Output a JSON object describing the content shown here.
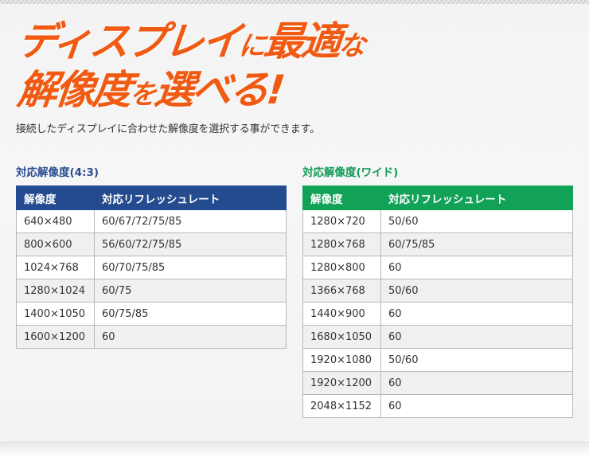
{
  "headline": {
    "line1_main": "ディスプレイ",
    "line1_particle": "に",
    "line1_end_main": "最適",
    "line1_end_particle": "な",
    "line2_main1": "解像度",
    "line2_particle": "を",
    "line2_main2": "選べる!"
  },
  "lead_text": "接続したディスプレイに合わせた解像度を選択する事ができます。",
  "left_table": {
    "title": "対応解像度(4:3)",
    "headers": [
      "解像度",
      "対応リフレッシュレート"
    ],
    "rows": [
      [
        "640×480",
        "60/67/72/75/85"
      ],
      [
        "800×600",
        "56/60/72/75/85"
      ],
      [
        "1024×768",
        "60/70/75/85"
      ],
      [
        "1280×1024",
        "60/75"
      ],
      [
        "1400×1050",
        "60/75/85"
      ],
      [
        "1600×1200",
        "60"
      ]
    ]
  },
  "right_table": {
    "title": "対応解像度(ワイド)",
    "headers": [
      "解像度",
      "対応リフレッシュレート"
    ],
    "rows": [
      [
        "1280×720",
        "50/60"
      ],
      [
        "1280×768",
        "60/75/85"
      ],
      [
        "1280×800",
        "60"
      ],
      [
        "1366×768",
        "50/60"
      ],
      [
        "1440×900",
        "60"
      ],
      [
        "1680×1050",
        "60"
      ],
      [
        "1920×1080",
        "50/60"
      ],
      [
        "1920×1200",
        "60"
      ],
      [
        "2048×1152",
        "60"
      ]
    ]
  },
  "colors": {
    "headline": "#f15a12",
    "left_header": "#244b8f",
    "right_header": "#11a257",
    "left_title": "#2a4d8f",
    "right_title": "#0e9a55"
  }
}
